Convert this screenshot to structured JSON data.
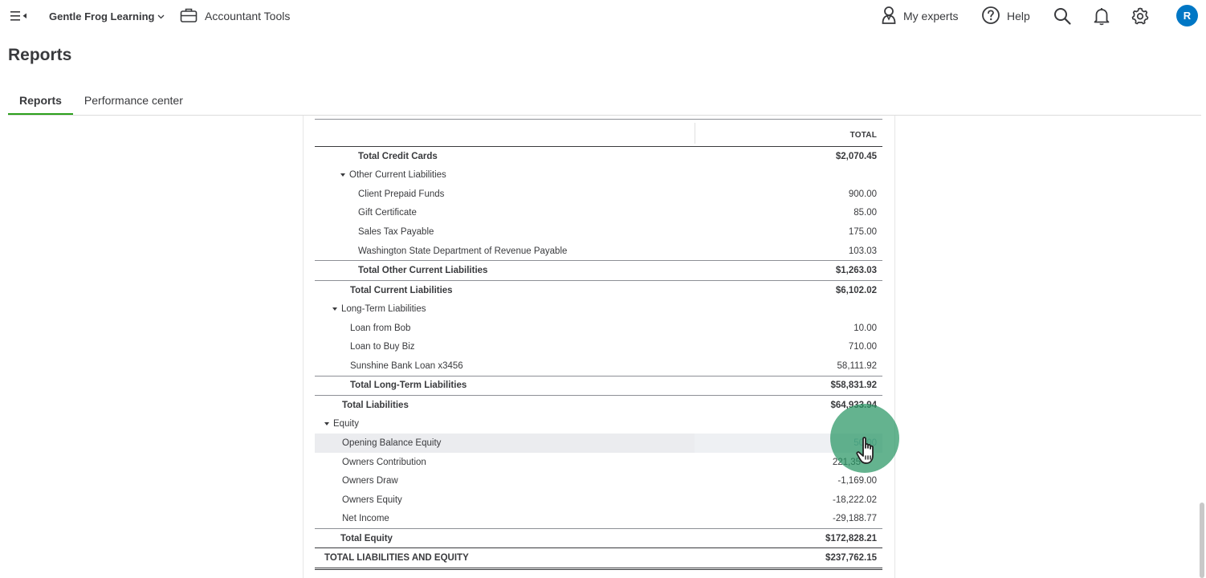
{
  "topbar": {
    "company_name": "Gentle Frog Learning",
    "accountant_tools": "Accountant Tools",
    "my_experts": "My experts",
    "help": "Help",
    "avatar_initial": "R"
  },
  "page": {
    "title": "Reports",
    "tabs": [
      {
        "label": "Reports",
        "active": true
      },
      {
        "label": "Performance center",
        "active": false
      }
    ]
  },
  "report": {
    "column_header": "TOTAL",
    "rows": [
      {
        "label": "Total Credit Cards",
        "amount": "$2,070.45"
      },
      {
        "label": "Other Current Liabilities",
        "amount": ""
      },
      {
        "label": "Client Prepaid Funds",
        "amount": "900.00"
      },
      {
        "label": "Gift Certificate",
        "amount": "85.00"
      },
      {
        "label": "Sales Tax Payable",
        "amount": "175.00"
      },
      {
        "label": "Washington State Department of Revenue Payable",
        "amount": "103.03"
      },
      {
        "label": "Total Other Current Liabilities",
        "amount": "$1,263.03"
      },
      {
        "label": "Total Current Liabilities",
        "amount": "$6,102.02"
      },
      {
        "label": "Long-Term Liabilities",
        "amount": ""
      },
      {
        "label": "Loan from Bob",
        "amount": "10.00"
      },
      {
        "label": "Loan to Buy Biz",
        "amount": "710.00"
      },
      {
        "label": "Sunshine Bank Loan x3456",
        "amount": "58,111.92"
      },
      {
        "label": "Total Long-Term Liabilities",
        "amount": "$58,831.92"
      },
      {
        "label": "Total Liabilities",
        "amount": "$64,933.94"
      },
      {
        "label": "Equity",
        "amount": ""
      },
      {
        "label": "Opening Balance Equity",
        "amount": "50.00"
      },
      {
        "label": "Owners Contribution",
        "amount": "221,35"
      },
      {
        "label": "Owners Draw",
        "amount": "-1,169.00"
      },
      {
        "label": "Owners Equity",
        "amount": "-18,222.02"
      },
      {
        "label": "Net Income",
        "amount": "-29,188.77"
      },
      {
        "label": "Total Equity",
        "amount": "$172,828.21"
      },
      {
        "label": "TOTAL LIABILITIES AND EQUITY",
        "amount": "$237,762.15"
      }
    ]
  },
  "icons": {
    "menu": "menu-toggle-icon",
    "company_dropdown": "chevron-down-icon",
    "accountant_tools": "briefcase-icon",
    "my_experts": "person-icon",
    "help": "help-circle-icon",
    "search": "search-icon",
    "notifications": "bell-icon",
    "settings": "gear-icon",
    "pointer": "hand-pointer-icon"
  },
  "colors": {
    "accent_green": "#2ca01c",
    "avatar_blue": "#0077c5",
    "click_indicator": "#2e9668",
    "row_highlight": "#ebecef"
  }
}
